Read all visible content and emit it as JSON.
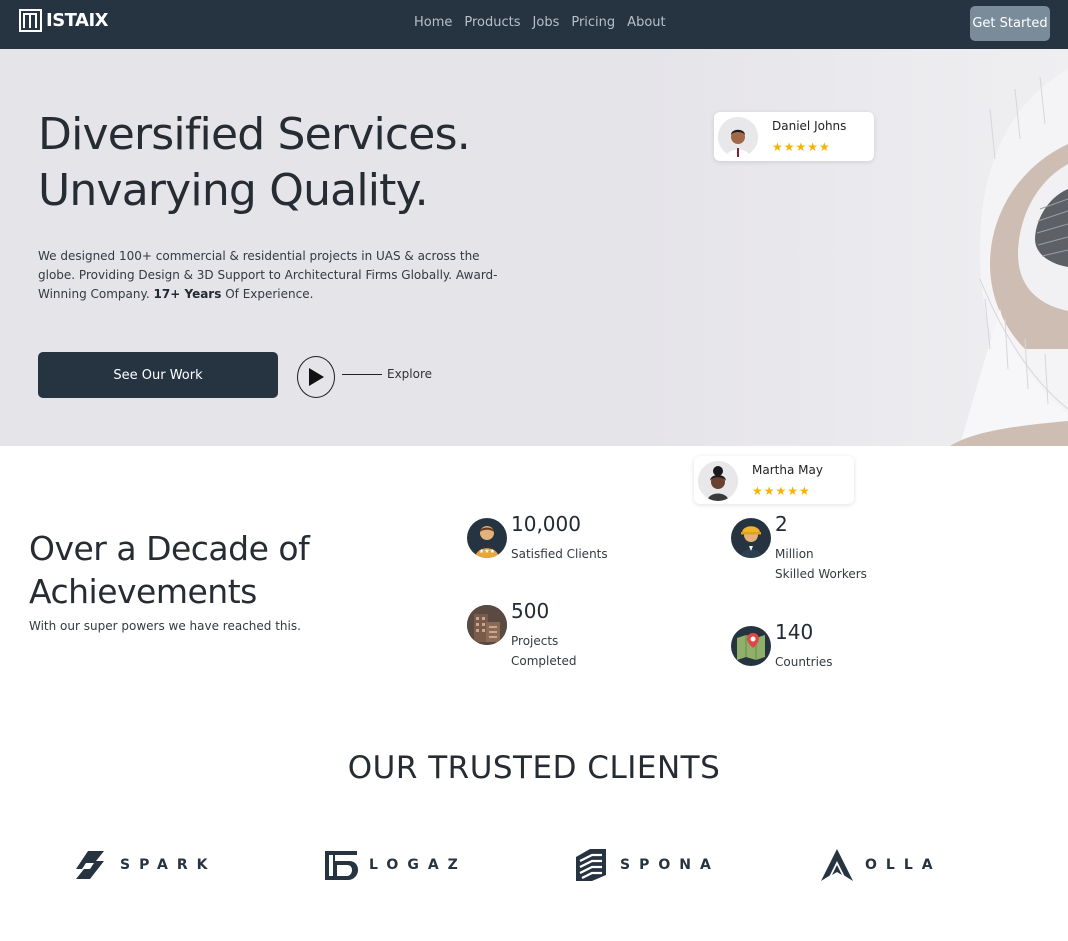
{
  "navbar": {
    "brand": "ISTAIX",
    "links": [
      "Home",
      "Products",
      "Jobs",
      "Pricing",
      "About"
    ],
    "cta": "Get Started"
  },
  "hero": {
    "headline_line1": "Diversified Services.",
    "headline_line2": "Unvarying Quality.",
    "description_part1": "We designed 100+ commercial & residential projects in UAS & across the globe. Providing Design & 3D Support to Architectural Firms Globally. Award-Winning Company.",
    "description_bold": "17+ Years",
    "description_part2": "Of Experience.",
    "primary_button": "See Our Work",
    "explore_label": "Explore"
  },
  "reviews": [
    {
      "name": "Daniel Johns",
      "rating": 5,
      "stars": "★★★★★"
    },
    {
      "name": "Martha May",
      "rating": 5,
      "stars": "★★★★★"
    }
  ],
  "achievements": {
    "title_line1": "Over a Decade of",
    "title_line2": "Achievements",
    "subtitle": "With our super powers we have reached this.",
    "stats": [
      {
        "value": "10,000",
        "label_line1": "Satisfied Clients",
        "label_line2": "",
        "icon": "satisfied-client-icon"
      },
      {
        "value": "2",
        "label_line1": "Million",
        "label_line2": "Skilled Workers",
        "icon": "skilled-worker-icon"
      },
      {
        "value": "500",
        "label_line1": "Projects",
        "label_line2": "Completed",
        "icon": "building-icon"
      },
      {
        "value": "140",
        "label_line1": "Countries",
        "label_line2": "",
        "icon": "map-pin-icon"
      }
    ]
  },
  "clients": {
    "title": "OUR TRUSTED CLIENTS",
    "logos": [
      {
        "name": "SPARK",
        "icon": "spark-logo-icon"
      },
      {
        "name": "LOGAZ",
        "icon": "logaz-logo-icon"
      },
      {
        "name": "SPONA",
        "icon": "spona-logo-icon"
      },
      {
        "name": "OLLA",
        "icon": "olla-logo-icon"
      }
    ]
  },
  "colors": {
    "navbar_bg": "#263340",
    "hero_bg": "#e5e4e9",
    "cta_bg": "#7a8c9a",
    "star": "#f5b400",
    "text_dark": "#262c33"
  }
}
